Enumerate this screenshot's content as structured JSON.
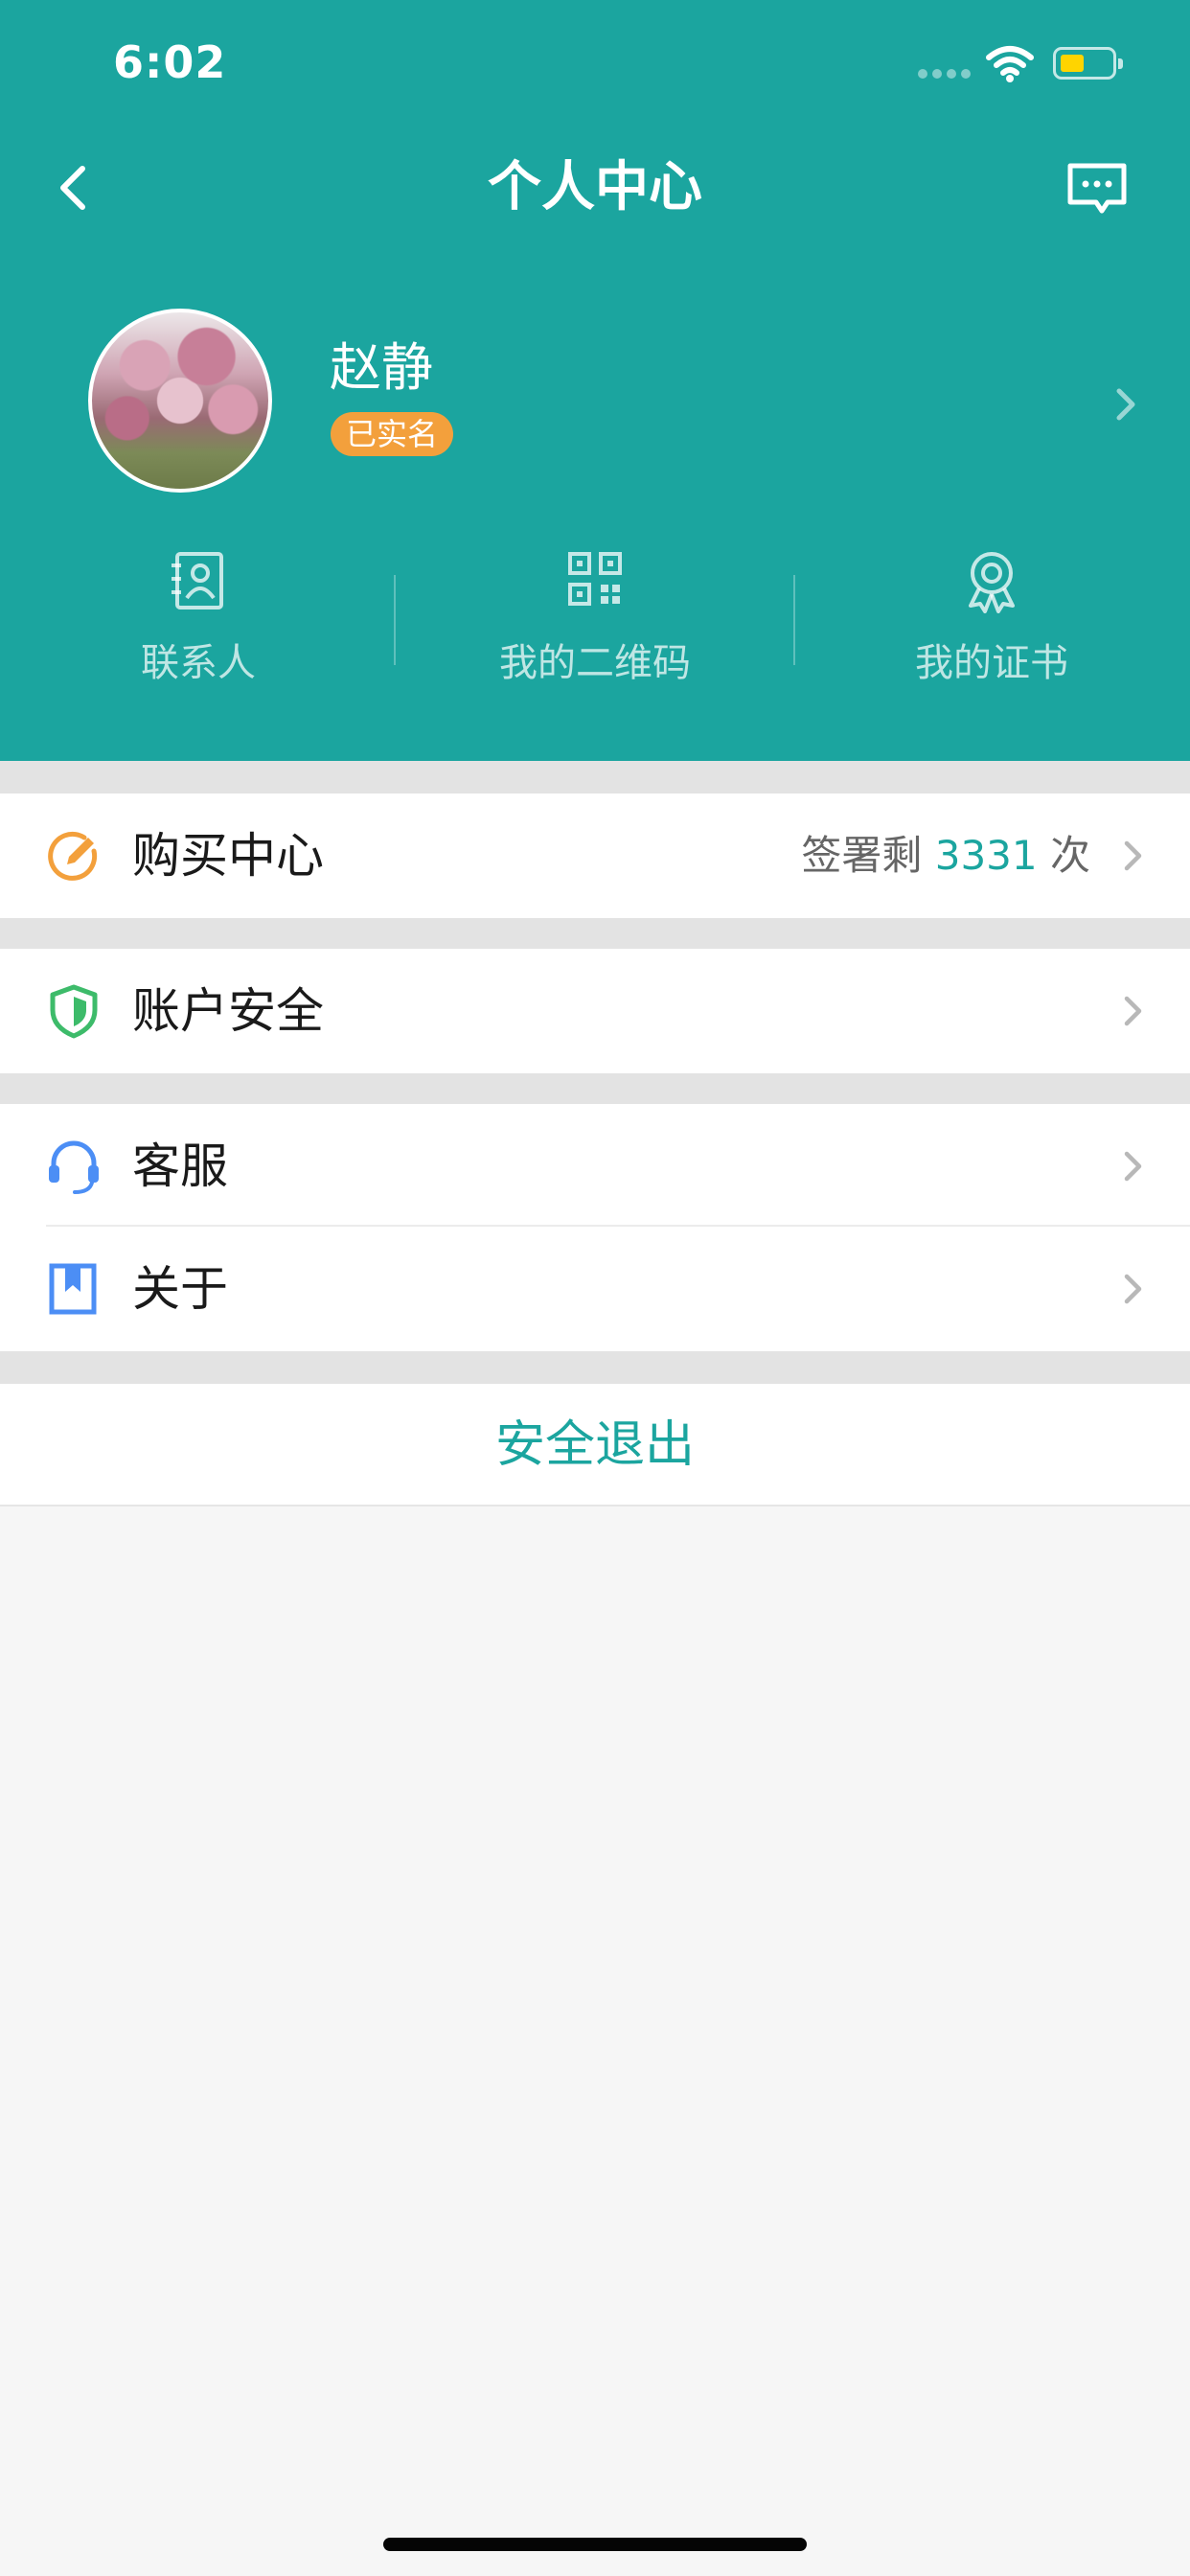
{
  "status_bar": {
    "time": "6:02"
  },
  "nav": {
    "title": "个人中心",
    "back_icon": "chevron-left-icon",
    "message_icon": "message-icon"
  },
  "profile": {
    "name": "赵静",
    "badge": "已实名"
  },
  "shortcuts": [
    {
      "label": "联系人",
      "icon": "contact-icon"
    },
    {
      "label": "我的二维码",
      "icon": "qrcode-icon"
    },
    {
      "label": "我的证书",
      "icon": "certificate-icon"
    }
  ],
  "menu": {
    "purchase": {
      "label": "购买中心",
      "remaining_prefix": "签署剩",
      "remaining_count": "3331",
      "remaining_suffix": "次",
      "icon": "edit-icon"
    },
    "security": {
      "label": "账户安全",
      "icon": "shield-icon"
    },
    "service": {
      "label": "客服",
      "icon": "headset-icon"
    },
    "about": {
      "label": "关于",
      "icon": "bookmark-icon"
    }
  },
  "logout": {
    "label": "安全退出"
  },
  "colors": {
    "primary": "#1ba59f",
    "badge": "#f3a03c",
    "purchase_icon": "#f3a03c",
    "security_icon": "#3dbb6a",
    "service_icon": "#4c8ef5",
    "about_icon": "#4c8ef5",
    "battery": "#ffd400"
  }
}
